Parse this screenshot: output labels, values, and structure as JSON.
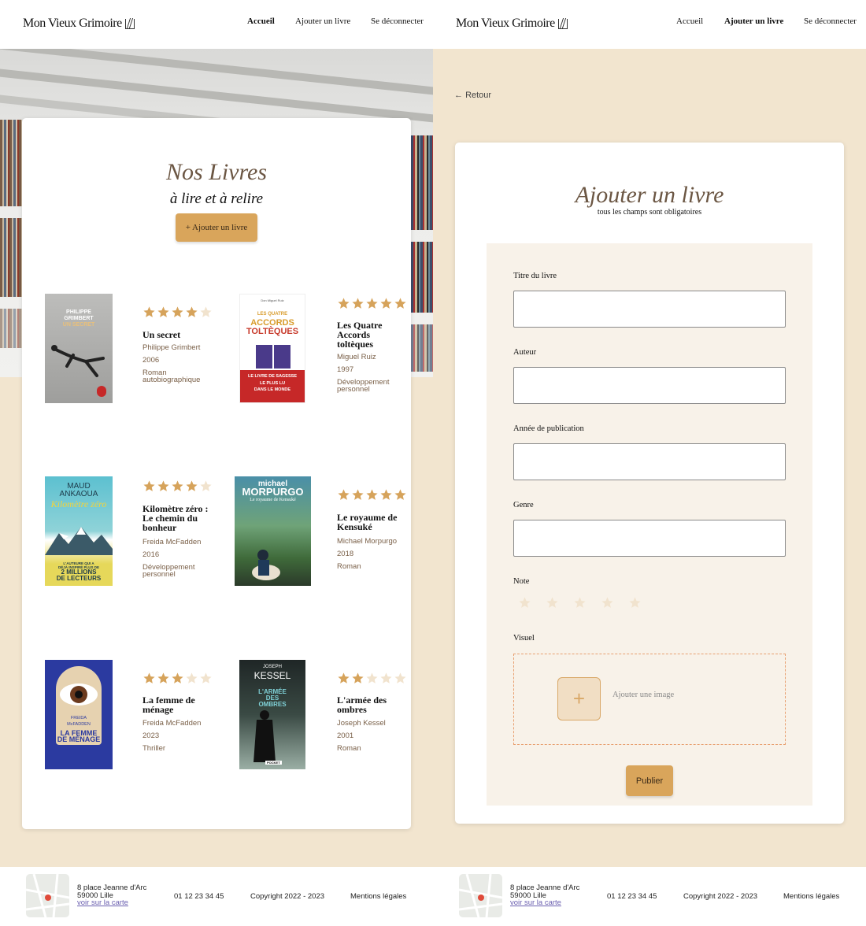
{
  "header": {
    "logo": "Mon Vieux Grimoire",
    "nav": [
      "Accueil",
      "Ajouter un livre",
      "Se déconnecter"
    ]
  },
  "books_page": {
    "title": "Nos Livres",
    "subtitle": "à lire et à relire",
    "add_button": "+ Ajouter un livre",
    "books": [
      {
        "title": "Un secret",
        "author": "Philippe Grimbert",
        "year": "2006",
        "genre": "Roman autobiographique",
        "rating": 4,
        "cover_lines": [
          "PHILIPPE",
          "GRIMBERT",
          "UN SECRET"
        ]
      },
      {
        "title": "Les Quatre Accords toltèques",
        "author": "Miguel Ruiz",
        "year": "1997",
        "genre": "Développement personnel",
        "rating": 5,
        "cover_lines": [
          "Don Miguel Ruiz",
          "LES QUATRE",
          "ACCORDS",
          "TOLTÈQUES",
          "LE LIVRE DE SAGESSE",
          "LE PLUS LU",
          "DANS LE MONDE"
        ]
      },
      {
        "title": "Kilomètre zéro : Le chemin du bonheur",
        "author": "Freida McFadden",
        "year": "2016",
        "genre": "Développement personnel",
        "rating": 4,
        "cover_lines": [
          "MAUD",
          "ANKAOUA",
          "Kilomètre zéro",
          "L'AUTEURE QUI A",
          "DÉJÀ INSPIRÉ PLUS DE",
          "2 MILLIONS",
          "DE LECTEURS"
        ]
      },
      {
        "title": "Le royaume de Kensuké",
        "author": "Michael Morpurgo",
        "year": "2018",
        "genre": "Roman",
        "rating": 5,
        "cover_lines": [
          "michael",
          "MORPURGO",
          "Le royaume de Kensuké"
        ]
      },
      {
        "title": "La femme de ménage",
        "author": "Freida McFadden",
        "year": "2023",
        "genre": "Thriller",
        "rating": 3,
        "cover_lines": [
          "FREIDA",
          "McFADDEN",
          "LA FEMME",
          "DE MÉNAGE"
        ]
      },
      {
        "title": "L'armée des ombres",
        "author": "Joseph Kessel",
        "year": "2001",
        "genre": "Roman",
        "rating": 2,
        "cover_lines": [
          "JOSEPH",
          "KESSEL",
          "L'ARMÉE",
          "DES",
          "OMBRES",
          "POCKET"
        ]
      }
    ]
  },
  "form_page": {
    "back": "Retour",
    "title": "Ajouter un livre",
    "subtitle": "tous les champs sont obligatoires",
    "fields": {
      "title_label": "Titre du livre",
      "author_label": "Auteur",
      "year_label": "Année de publication",
      "genre_label": "Genre",
      "rating_label": "Note",
      "visual_label": "Visuel"
    },
    "values": {
      "title": "",
      "author": "",
      "year": "",
      "genre": ""
    },
    "rating": 0,
    "add_image": "Ajouter une image",
    "plus": "+",
    "submit": "Publier"
  },
  "footer": {
    "address_line1": "8 place Jeanne d'Arc",
    "address_line2": "59000 Lille",
    "map_link": "voir sur la carte",
    "phone": "01 12 23 34 45",
    "copyright": "Copyright 2022 - 2023",
    "legal": "Mentions légales"
  },
  "colors": {
    "accent": "#D9A55B",
    "star_full": "#D6A35B",
    "star_empty": "#F1E3CE",
    "background": "#F2E5CF",
    "title": "#6B5643"
  }
}
